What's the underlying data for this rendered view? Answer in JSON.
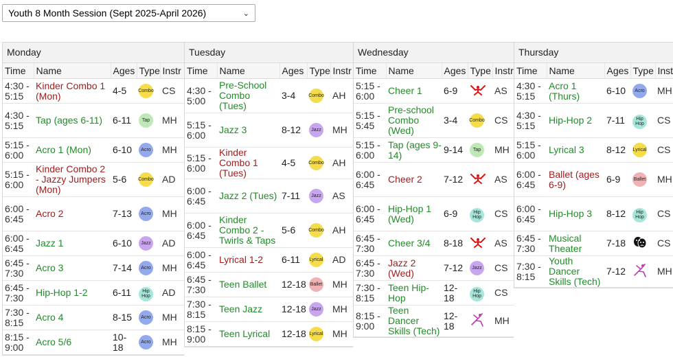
{
  "session": {
    "selected": "Youth 8 Month Session (Sept 2025-April 2026)"
  },
  "columns": {
    "time": "Time",
    "name": "Name",
    "ages": "Ages",
    "type": "Type",
    "instr": "Instr"
  },
  "colors": {
    "open_class": "#238b2a",
    "full_class": "#a11d1d"
  },
  "days": [
    {
      "title": "Monday",
      "rows": [
        {
          "time": "4:30 - 5:15",
          "name": "Kinder Combo 1 (Mon)",
          "ages": "4-5",
          "type": "Combo",
          "instr": "CS",
          "status": "red"
        },
        {
          "time": "4:30 - 5:15",
          "name": "Tap (ages 6-11)",
          "ages": "6-11",
          "type": "Tap",
          "instr": "MH",
          "status": "green"
        },
        {
          "time": "5:15 - 6:00",
          "name": "Acro 1 (Mon)",
          "ages": "6-10",
          "type": "Acro",
          "instr": "MH",
          "status": "green"
        },
        {
          "time": "5:15 - 6:00",
          "name": "Kinder Combo 2 - Jazzy Jumpers (Mon)",
          "ages": "5-6",
          "type": "Combo",
          "instr": "AD",
          "status": "red"
        },
        {
          "time": "6:00 - 6:45",
          "name": "Acro 2",
          "ages": "7-13",
          "type": "Acro",
          "instr": "MH",
          "status": "red"
        },
        {
          "time": "6:00 - 6:45",
          "name": "Jazz 1",
          "ages": "6-10",
          "type": "Jazz",
          "instr": "AD",
          "status": "green"
        },
        {
          "time": "6:45 - 7:30",
          "name": "Acro 3",
          "ages": "7-14",
          "type": "Acro",
          "instr": "MH",
          "status": "green"
        },
        {
          "time": "6:45 - 7:30",
          "name": "Hip-Hop 1-2",
          "ages": "6-11",
          "type": "Hip Hop",
          "instr": "AD",
          "status": "green"
        },
        {
          "time": "7:30 - 8:15",
          "name": "Acro 4",
          "ages": "8-15",
          "type": "Acro",
          "instr": "MH",
          "status": "green"
        },
        {
          "time": "8:15 - 9:00",
          "name": "Acro 5/6",
          "ages": "10-18",
          "type": "Acro",
          "instr": "MH",
          "status": "green"
        }
      ]
    },
    {
      "title": "Tuesday",
      "rows": [
        {
          "time": "4:30 - 5:00",
          "name": "Pre-School Combo (Tues)",
          "ages": "3-4",
          "type": "Combo",
          "instr": "AH",
          "status": "green"
        },
        {
          "time": "5:15 - 6:00",
          "name": "Jazz 3",
          "ages": "8-12",
          "type": "Jazz",
          "instr": "MH",
          "status": "green"
        },
        {
          "time": "5:15 - 6:00",
          "name": "Kinder Combo 1 (Tues)",
          "ages": "4-5",
          "type": "Combo",
          "instr": "AH",
          "status": "red"
        },
        {
          "time": "6:00 - 6:45",
          "name": "Jazz 2 (Tues)",
          "ages": "7-11",
          "type": "Jazz",
          "instr": "AS",
          "status": "green"
        },
        {
          "time": "6:00 - 6:45",
          "name": "Kinder Combo 2 - Twirls & Taps",
          "ages": "5-6",
          "type": "Combo",
          "instr": "AH",
          "status": "green"
        },
        {
          "time": "6:00 - 6:45",
          "name": "Lyrical 1-2",
          "ages": "6-11",
          "type": "Lyrical",
          "instr": "AD",
          "status": "red"
        },
        {
          "time": "6:45 - 7:30",
          "name": "Teen Ballet",
          "ages": "12-18",
          "type": "Ballet",
          "instr": "MH",
          "status": "green"
        },
        {
          "time": "7:30 - 8:15",
          "name": "Teen Jazz",
          "ages": "12-18",
          "type": "Jazz",
          "instr": "MH",
          "status": "green"
        },
        {
          "time": "8:15 - 9:00",
          "name": "Teen Lyrical",
          "ages": "12-18",
          "type": "Lyrical",
          "instr": "MH",
          "status": "green"
        }
      ]
    },
    {
      "title": "Wednesday",
      "rows": [
        {
          "time": "5:15 - 6:00",
          "name": "Cheer 1",
          "ages": "6-9",
          "type": "Cheer",
          "instr": "AS",
          "status": "green"
        },
        {
          "time": "5:15 - 5:45",
          "name": "Pre-school Combo (Wed)",
          "ages": "3-4",
          "type": "Combo",
          "instr": "CS",
          "status": "green"
        },
        {
          "time": "5:15 - 6:00",
          "name": "Tap (ages 9-14)",
          "ages": "9-14",
          "type": "Tap",
          "instr": "MH",
          "status": "green"
        },
        {
          "time": "6:00 - 6:45",
          "name": "Cheer 2",
          "ages": "7-12",
          "type": "Cheer",
          "instr": "AS",
          "status": "red"
        },
        {
          "time": "6:00 - 6:45",
          "name": "Hip-Hop 1 (Wed)",
          "ages": "6-9",
          "type": "Hip Hop",
          "instr": "CS",
          "status": "green"
        },
        {
          "time": "6:45 - 7:30",
          "name": "Cheer 3/4",
          "ages": "8-18",
          "type": "Cheer",
          "instr": "AS",
          "status": "green"
        },
        {
          "time": "6:45 - 7:30",
          "name": "Jazz 2 (Wed)",
          "ages": "7-12",
          "type": "Jazz",
          "instr": "CS",
          "status": "red"
        },
        {
          "time": "7:30 - 8:15",
          "name": "Teen Hip-Hop",
          "ages": "12-18",
          "type": "Hip Hop",
          "instr": "CS",
          "status": "green"
        },
        {
          "time": "8:15 - 9:00",
          "name": "Teen Dancer Skills (Tech)",
          "ages": "12-18",
          "type": "Tech",
          "instr": "MH",
          "status": "green"
        }
      ]
    },
    {
      "title": "Thursday",
      "rows": [
        {
          "time": "4:30 - 5:15",
          "name": "Acro 1 (Thurs)",
          "ages": "6-10",
          "type": "Acro",
          "instr": "MH",
          "status": "green"
        },
        {
          "time": "4:30 - 5:15",
          "name": "Hip-Hop 2",
          "ages": "7-11",
          "type": "Hip Hop",
          "instr": "CS",
          "status": "green"
        },
        {
          "time": "5:15 - 6:00",
          "name": "Lyrical 3",
          "ages": "8-12",
          "type": "Lyrical",
          "instr": "CS",
          "status": "green"
        },
        {
          "time": "6:00 - 6:45",
          "name": "Ballet (ages 6-9)",
          "ages": "6-9",
          "type": "Ballet",
          "instr": "MH",
          "status": "red"
        },
        {
          "time": "6:00 - 6:45",
          "name": "Hip-Hop 3",
          "ages": "8-12",
          "type": "Hip Hop",
          "instr": "CS",
          "status": "green"
        },
        {
          "time": "6:45 - 7:30",
          "name": "Musical Theater",
          "ages": "7-18",
          "type": "Theater",
          "instr": "CS",
          "status": "green"
        },
        {
          "time": "7:30 - 8:15",
          "name": "Youth Dancer Skills (Tech)",
          "ages": "7-12",
          "type": "Tech",
          "instr": "MH",
          "status": "green"
        }
      ]
    }
  ]
}
